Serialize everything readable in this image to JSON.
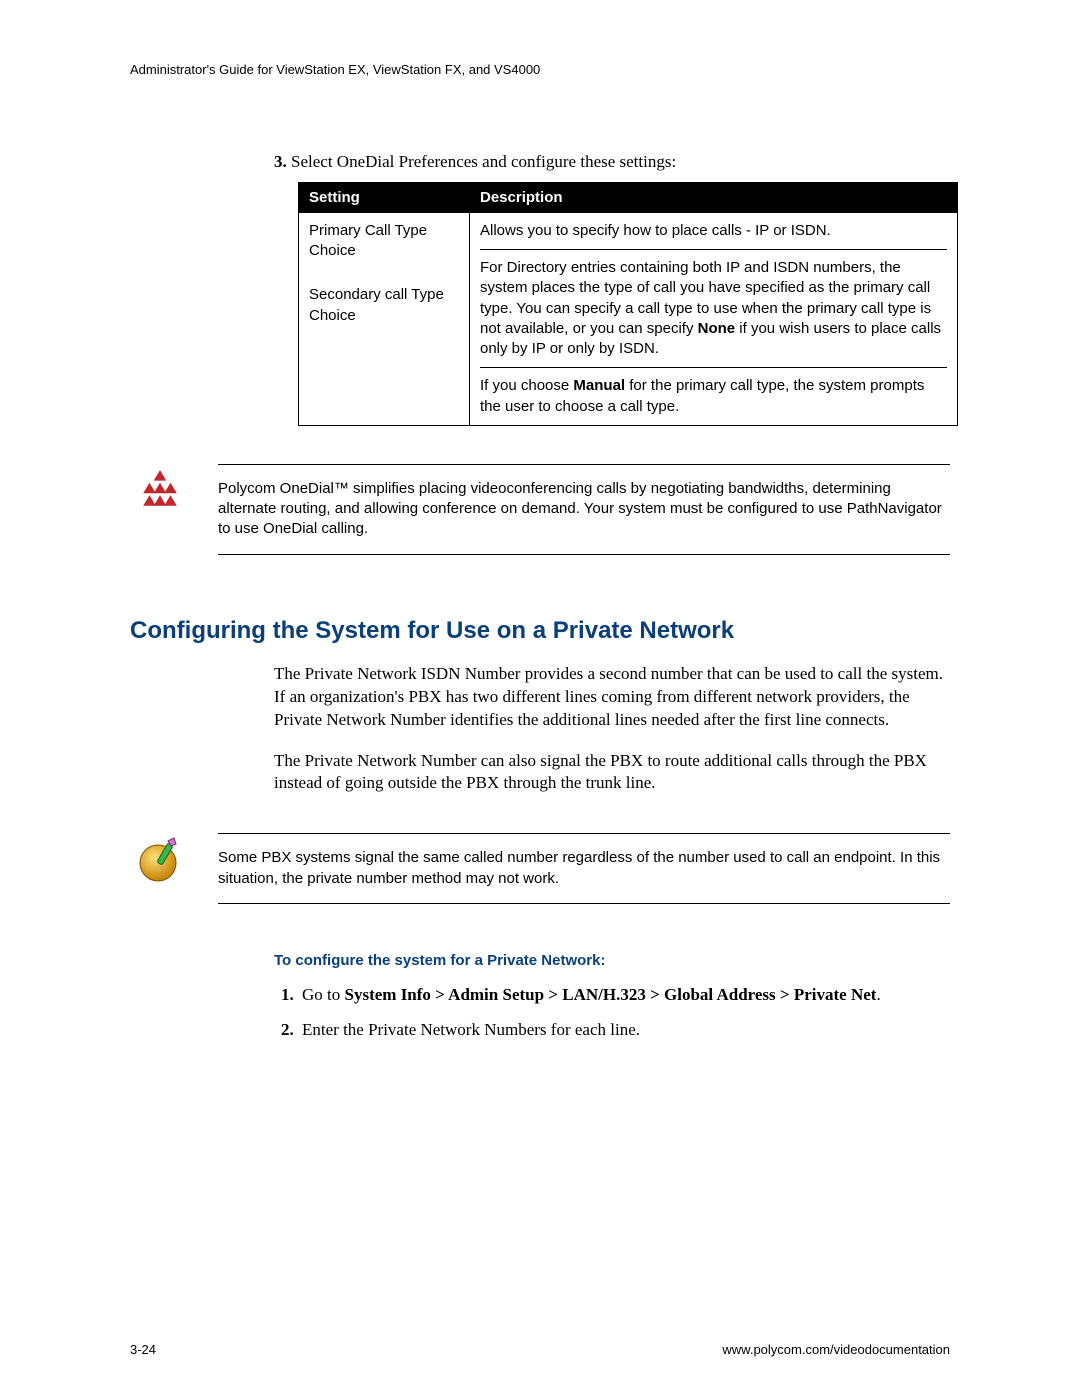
{
  "running_head": "Administrator's Guide for ViewStation EX, ViewStation FX, and VS4000",
  "step3": {
    "num": "3.",
    "text": "Select OneDial Preferences and configure these settings:"
  },
  "table": {
    "headers": {
      "setting": "Setting",
      "description": "Description"
    },
    "rows": [
      {
        "setting": "Primary Call Type Choice",
        "setting2": "Secondary call Type Choice",
        "desc1": "Allows you to specify how to place calls - IP or ISDN.",
        "desc2a": "For Directory entries containing both IP and ISDN numbers, the system places the type of call you have specified as the primary call type. You can specify a call type to use when the primary call type is not available, or you can specify ",
        "desc2b": "None",
        "desc2c": " if you wish users to place calls only by IP or only by ISDN.",
        "desc3a": "If you choose ",
        "desc3b": "Manual",
        "desc3c": " for the primary call type, the system prompts the user to choose a call type."
      }
    ]
  },
  "callout1": "Polycom OneDial™ simplifies placing videoconferencing calls by negotiating bandwidths, determining alternate routing, and allowing conference on demand. Your system must be configured to use PathNavigator to use OneDial calling.",
  "section_heading": "Configuring the System for Use on a Private Network",
  "para1": "The Private Network ISDN Number provides a second number that can be used to call the system. If an organization's PBX has two different lines coming from different network providers, the Private Network Number identifies the additional lines needed after the first line connects.",
  "para2": "The Private Network Number can also signal the PBX to route additional calls through the PBX instead of going outside the PBX through the trunk line.",
  "callout2": "Some PBX systems signal the same called number regardless of the number used to call an endpoint. In this situation, the private number method may not work.",
  "sub_head": "To configure the system for a Private Network:",
  "steps": {
    "s1a": "Go to ",
    "s1b": "System Info > Admin Setup > LAN/H.323 > Global Address > Private Net",
    "s1c": ".",
    "s2": "Enter the Private Network Numbers for each line."
  },
  "footer": {
    "left": "3-24",
    "right": "www.polycom.com/videodocumentation"
  }
}
